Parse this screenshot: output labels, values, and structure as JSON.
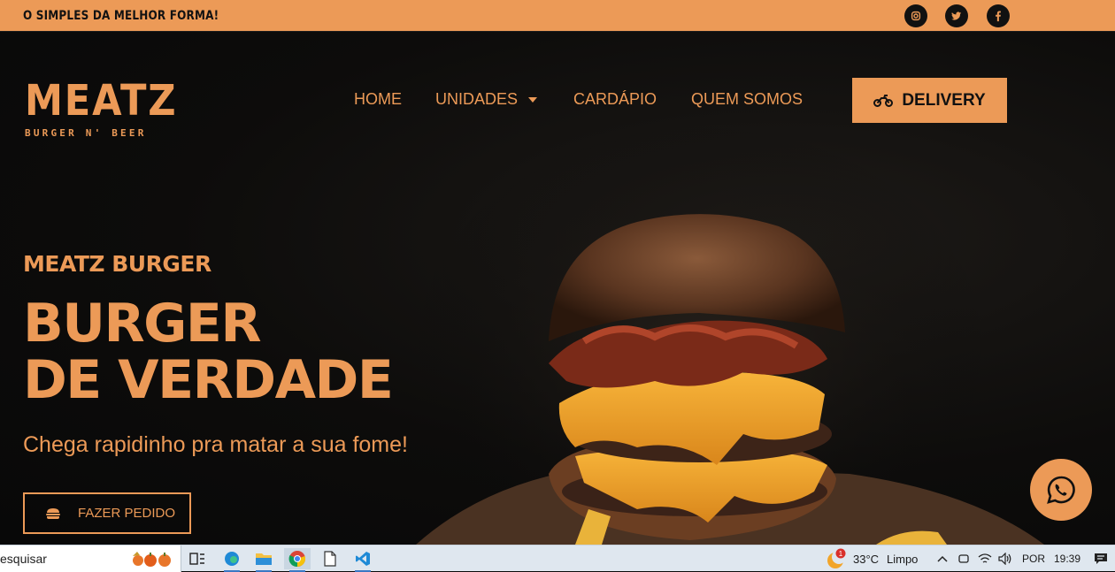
{
  "topbar": {
    "slogan": "O SIMPLES DA MELHOR FORMA!",
    "social_icons": [
      "instagram-icon",
      "twitter-icon",
      "facebook-icon"
    ]
  },
  "logo": {
    "word": "MEATZ",
    "subtitle": "BURGER N' BEER"
  },
  "nav": {
    "items": [
      {
        "label": "HOME"
      },
      {
        "label": "UNIDADES",
        "has_dropdown": true
      },
      {
        "label": "CARDÁPIO"
      },
      {
        "label": "QUEM SOMOS"
      }
    ],
    "delivery_label": "DELIVERY",
    "delivery_icon": "motorcycle-icon"
  },
  "hero": {
    "kicker": "MEATZ BURGER",
    "headline_line1": "BURGER",
    "headline_line2": "DE VERDADE",
    "tagline": "Chega rapidinho pra matar a sua fome!",
    "cta_label": "FAZER PEDIDO",
    "cta_icon": "burger-icon"
  },
  "floating": {
    "icon": "whatsapp-icon"
  },
  "taskbar": {
    "search_text": "esquisar",
    "apps": [
      "task-view-icon",
      "edge-icon",
      "file-explorer-icon",
      "chrome-icon",
      "notepad-icon",
      "vscode-icon"
    ],
    "weather_temp": "33°C",
    "weather_desc": "Limpo",
    "weather_badge": "1",
    "language": "POR",
    "time": "19:39"
  },
  "colors": {
    "accent": "#ec9a57",
    "dark": "#111111"
  }
}
